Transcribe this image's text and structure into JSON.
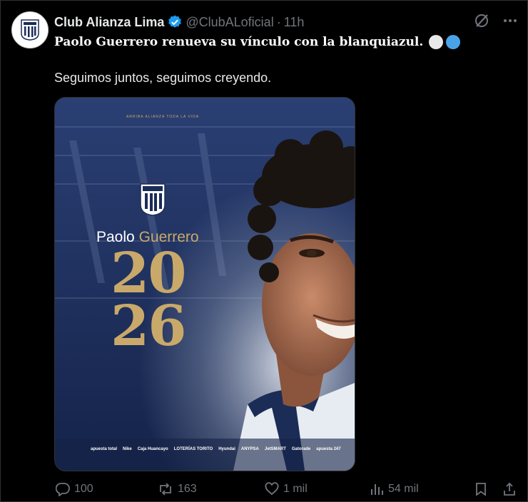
{
  "account": {
    "name": "Club Alianza Lima",
    "handle": "@ClubALoficial",
    "separator": "·",
    "time": "11h"
  },
  "post": {
    "headline": "Paolo Guerrero renueva su vínculo con la blanquiazul.",
    "subtext": "Seguimos juntos, seguimos creyendo."
  },
  "emoji_colors": [
    "#e8e8e8",
    "#4aa3e8"
  ],
  "image": {
    "top_banner": "ARRIBA ALIANZA TODA LA VIDA",
    "crest_text": "ALIANZA LIMA",
    "first_name": "Paolo",
    "last_name": "Guerrero",
    "year_top": "20",
    "year_bottom": "26",
    "sponsors": [
      "apuesta total",
      "Nike",
      "Caja Huancayo",
      "LOTERÍAS TORITO",
      "Hyundai",
      "ANYPSA",
      "JetSMART",
      "Gatorade",
      "apuesta 247"
    ]
  },
  "actions": {
    "replies": "100",
    "reposts": "163",
    "likes": "1 mil",
    "views": "54 mil"
  },
  "colors": {
    "verified": "#1d9bf0",
    "gold": "#c9a96a",
    "navy": "#1b2c56"
  }
}
